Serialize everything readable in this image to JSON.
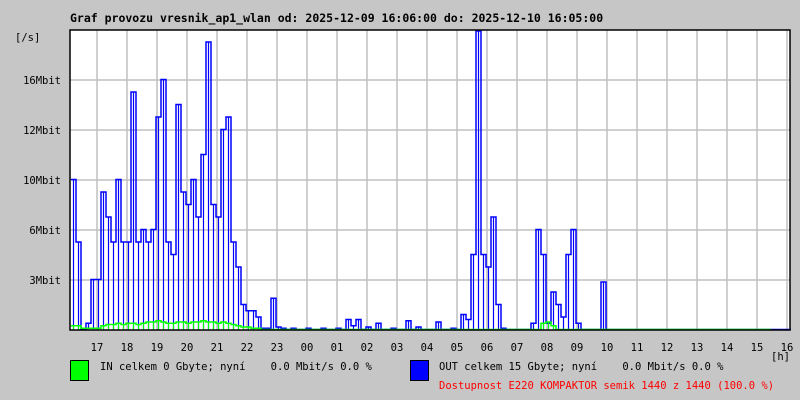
{
  "chart_data": {
    "type": "line",
    "title": "Graf provozu vresnik_ap1_wlan od: 2025-12-09 16:06:00 do: 2025-12-10 16:05:00",
    "ylabel": "[/s]",
    "xlabel": "[h]",
    "x_start": "16:06",
    "x_step_minutes": 10,
    "xlim_hours": [
      16.1,
      40.1
    ],
    "ylim": [
      0,
      24
    ],
    "grid": true,
    "x_ticks": [
      {
        "hour": 17,
        "label": "17"
      },
      {
        "hour": 18,
        "label": "18"
      },
      {
        "hour": 19,
        "label": "19"
      },
      {
        "hour": 20,
        "label": "20"
      },
      {
        "hour": 21,
        "label": "21"
      },
      {
        "hour": 22,
        "label": "22"
      },
      {
        "hour": 23,
        "label": "23"
      },
      {
        "hour": 24,
        "label": "00"
      },
      {
        "hour": 25,
        "label": "01"
      },
      {
        "hour": 26,
        "label": "02"
      },
      {
        "hour": 27,
        "label": "03"
      },
      {
        "hour": 28,
        "label": "04"
      },
      {
        "hour": 29,
        "label": "05"
      },
      {
        "hour": 30,
        "label": "06"
      },
      {
        "hour": 31,
        "label": "07"
      },
      {
        "hour": 32,
        "label": "08"
      },
      {
        "hour": 33,
        "label": "09"
      },
      {
        "hour": 34,
        "label": "10"
      },
      {
        "hour": 35,
        "label": "11"
      },
      {
        "hour": 36,
        "label": "12"
      },
      {
        "hour": 37,
        "label": "13"
      },
      {
        "hour": 38,
        "label": "14"
      },
      {
        "hour": 39,
        "label": "15"
      },
      {
        "hour": 40,
        "label": "16"
      }
    ],
    "y_ticks": [
      {
        "value": 4,
        "label": "3Mbit"
      },
      {
        "value": 8,
        "label": "6Mbit"
      },
      {
        "value": 12,
        "label": "10Mbit"
      },
      {
        "value": 16,
        "label": "12Mbit"
      },
      {
        "value": 20,
        "label": "16Mbit"
      }
    ],
    "series": [
      {
        "name": "OUT",
        "color": "#0000ff",
        "values": [
          12,
          7,
          0,
          0.5,
          4,
          4,
          11,
          9,
          7,
          12,
          7,
          7,
          19,
          7,
          8,
          7,
          8,
          17,
          20,
          7,
          6,
          18,
          11,
          10,
          12,
          9,
          14,
          23,
          10,
          9,
          16,
          17,
          7,
          5,
          2,
          1.5,
          1.5,
          1,
          0.1,
          0.1,
          2.5,
          0.2,
          0.1,
          0,
          0.1,
          0,
          0,
          0.1,
          0,
          0,
          0.1,
          0,
          0,
          0.1,
          0,
          0.8,
          0.3,
          0.8,
          0,
          0.2,
          0,
          0.5,
          0,
          0,
          0.1,
          0,
          0,
          0.7,
          0,
          0.2,
          0,
          0,
          0,
          0.6,
          0,
          0,
          0.1,
          0,
          1.2,
          0.8,
          6,
          24,
          6,
          5,
          9,
          2,
          0.1,
          0,
          0,
          0,
          0,
          0,
          0.5,
          8,
          6,
          0.5,
          3,
          2,
          1,
          6,
          8,
          0.5,
          0,
          0,
          0,
          0,
          3.8,
          0,
          0,
          0,
          0,
          0,
          0,
          0,
          0,
          0,
          0,
          0,
          0,
          0,
          0,
          0,
          0,
          0,
          0,
          0,
          0,
          0,
          0,
          0,
          0,
          0,
          0,
          0,
          0,
          0,
          0,
          0,
          0,
          0,
          0,
          0,
          0,
          0
        ]
      },
      {
        "name": "IN",
        "color": "#00ff00",
        "values": [
          0.3,
          0.3,
          0.1,
          0.1,
          0.1,
          0.1,
          0.3,
          0.4,
          0.4,
          0.5,
          0.4,
          0.5,
          0.5,
          0.4,
          0.5,
          0.6,
          0.6,
          0.7,
          0.6,
          0.5,
          0.5,
          0.6,
          0.6,
          0.5,
          0.6,
          0.6,
          0.7,
          0.6,
          0.6,
          0.5,
          0.6,
          0.5,
          0.4,
          0.3,
          0.2,
          0.2,
          0.1,
          0.1,
          0,
          0,
          0,
          0,
          0,
          0,
          0,
          0,
          0,
          0,
          0,
          0,
          0,
          0,
          0,
          0,
          0,
          0,
          0,
          0,
          0,
          0,
          0,
          0,
          0,
          0,
          0,
          0,
          0,
          0,
          0,
          0,
          0,
          0,
          0,
          0,
          0,
          0,
          0,
          0,
          0,
          0,
          0,
          0,
          0,
          0,
          0,
          0,
          0,
          0,
          0,
          0,
          0,
          0,
          0,
          0,
          0.5,
          0.6,
          0.3,
          0,
          0,
          0,
          0,
          0,
          0,
          0,
          0,
          0,
          0,
          0,
          0,
          0,
          0,
          0,
          0,
          0,
          0,
          0,
          0,
          0,
          0,
          0,
          0,
          0,
          0,
          0,
          0,
          0,
          0,
          0,
          0,
          0,
          0,
          0,
          0,
          0,
          0,
          0,
          0,
          0,
          0,
          0
        ]
      }
    ]
  },
  "legend": {
    "in_text": "IN celkem 0 Gbyte; nyní    0.0 Mbit/s 0.0 %",
    "out_text": "OUT celkem 15 Gbyte; nyní    0.0 Mbit/s 0.0 %",
    "availability_text": "Dostupnost E220 KOMPAKTOR semik 1440 z 1440 (100.0 %)",
    "in_color": "#00ff00",
    "out_color": "#0000ff",
    "availability_color": "#ff0000"
  }
}
